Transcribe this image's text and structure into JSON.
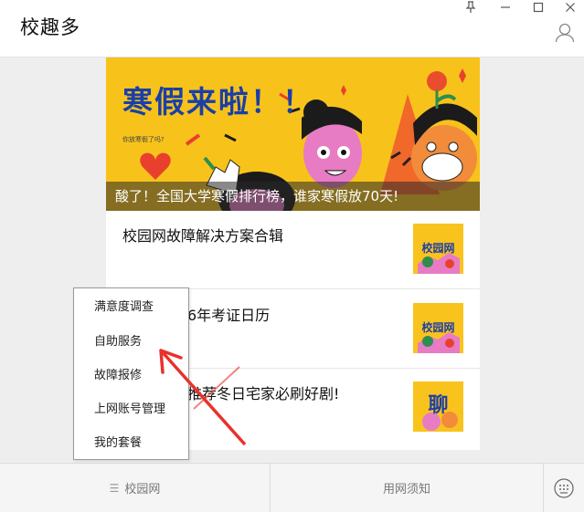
{
  "app": {
    "title": "校趣多"
  },
  "window_controls": [
    {
      "name": "pin-icon"
    },
    {
      "name": "minimize-icon"
    },
    {
      "name": "maximize-icon"
    },
    {
      "name": "close-icon"
    }
  ],
  "banner": {
    "headline": "寒假来啦！！",
    "small_text": "你放寒假了吗?",
    "caption": "酸了！全国大学寒假排行榜，谁家寒假放70天!"
  },
  "articles": [
    {
      "title": "校园网故障解决方案合辑",
      "thumb_text": "校园网"
    },
    {
      "title": "6年考证日历",
      "thumb_text": "校园网"
    },
    {
      "title": "推荐冬日宅家必刷好剧!",
      "thumb_text": "聊"
    }
  ],
  "popup_menu": {
    "items": [
      "满意度调查",
      "自助服务",
      "故障报修",
      "上网账号管理",
      "我的套餐"
    ]
  },
  "bottom_bar": {
    "tab_left": "校园网",
    "tab_right": "用网须知"
  },
  "colors": {
    "banner_yellow": "#f7c31b",
    "headline_blue": "#1a3fa8",
    "arrow_red": "#e8322a"
  }
}
